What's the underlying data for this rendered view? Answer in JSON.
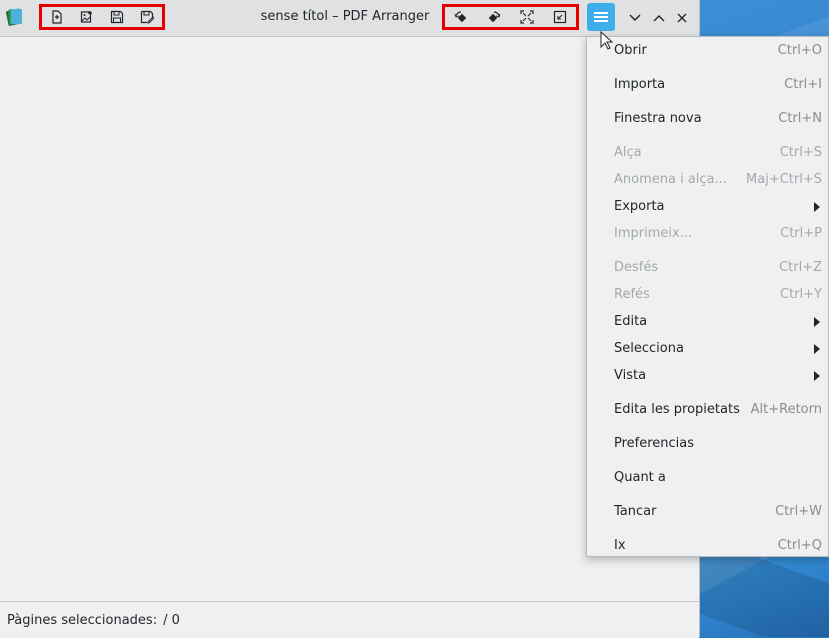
{
  "window": {
    "title": "sense títol – PDF Arranger"
  },
  "statusbar": {
    "label": "Pàgines seleccionades:",
    "value": "/ 0"
  },
  "toolbar_left": [
    {
      "name": "open-file-button",
      "icon": "document-open-icon"
    },
    {
      "name": "import-image-button",
      "icon": "image-add-icon"
    },
    {
      "name": "save-button",
      "icon": "floppy-disk-icon"
    },
    {
      "name": "save-as-button",
      "icon": "floppy-disk-edit-icon"
    }
  ],
  "toolbar_right": [
    {
      "name": "rotate-left-button",
      "icon": "rotate-left-icon"
    },
    {
      "name": "rotate-right-button",
      "icon": "rotate-right-icon"
    },
    {
      "name": "zoom-fit-button",
      "icon": "fullscreen-icon"
    },
    {
      "name": "zoom-in-out-button",
      "icon": "collapse-icon"
    }
  ],
  "menu": {
    "items": [
      {
        "label": "Obrir",
        "accel": "Ctrl+O",
        "enabled": true
      },
      {
        "label": "Importa",
        "accel": "Ctrl+I",
        "enabled": true
      },
      {
        "label": "Finestra nova",
        "accel": "Ctrl+N",
        "enabled": true
      },
      {
        "label": "Alça",
        "accel": "Ctrl+S",
        "enabled": false
      },
      {
        "label": "Anomena i alça...",
        "accel": "Maj+Ctrl+S",
        "enabled": false
      },
      {
        "label": "Exporta",
        "accel": "",
        "enabled": true,
        "submenu": true
      },
      {
        "label": "Imprimeix...",
        "accel": "Ctrl+P",
        "enabled": false
      },
      {
        "label": "Desfés",
        "accel": "Ctrl+Z",
        "enabled": false
      },
      {
        "label": "Refés",
        "accel": "Ctrl+Y",
        "enabled": false
      },
      {
        "label": "Edita",
        "accel": "",
        "enabled": true,
        "submenu": true
      },
      {
        "label": "Selecciona",
        "accel": "",
        "enabled": true,
        "submenu": true
      },
      {
        "label": "Vista",
        "accel": "",
        "enabled": true,
        "submenu": true
      },
      {
        "label": "Edita les propietats",
        "accel": "Alt+Retorn",
        "enabled": true
      },
      {
        "label": "Preferencias",
        "accel": "",
        "enabled": true
      },
      {
        "label": "Quant a",
        "accel": "",
        "enabled": true
      },
      {
        "label": "Tancar",
        "accel": "Ctrl+W",
        "enabled": true
      },
      {
        "label": "Ix",
        "accel": "Ctrl+Q",
        "enabled": true
      }
    ]
  },
  "colors": {
    "accent": "#3daee9",
    "highlight_border": "#e60000",
    "disabled_text": "#a5a8ab"
  }
}
